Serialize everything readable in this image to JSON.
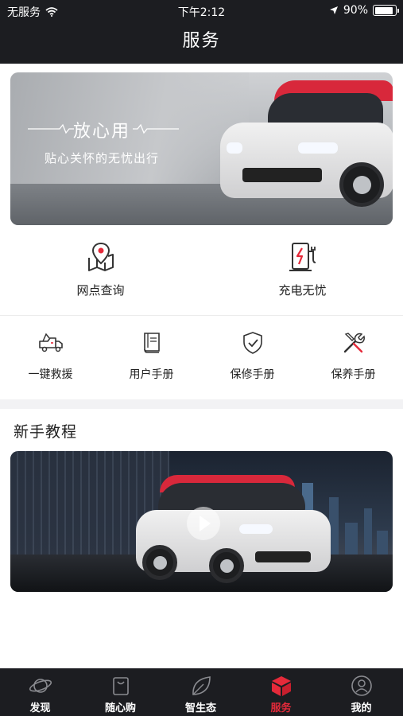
{
  "status_bar": {
    "carrier": "无服务",
    "time": "下午2:12",
    "battery": "90%",
    "battery_level": 0.9
  },
  "header": {
    "title": "服务"
  },
  "banner": {
    "headline": "放心用",
    "subtitle": "贴心关怀的无忧出行"
  },
  "quick_services": [
    {
      "label": "网点查询",
      "icon": "map-location-icon"
    },
    {
      "label": "充电无忧",
      "icon": "charging-station-icon"
    }
  ],
  "service_grid": [
    {
      "label": "一键救援",
      "icon": "tow-truck-icon"
    },
    {
      "label": "用户手册",
      "icon": "book-icon"
    },
    {
      "label": "保修手册",
      "icon": "shield-check-icon"
    },
    {
      "label": "保养手册",
      "icon": "tools-icon"
    }
  ],
  "tutorial": {
    "title": "新手教程"
  },
  "tabbar": {
    "active": "服务",
    "items": [
      {
        "label": "发现",
        "icon": "planet-icon"
      },
      {
        "label": "随心购",
        "icon": "shopping-bag-icon"
      },
      {
        "label": "智生态",
        "icon": "leaf-icon"
      },
      {
        "label": "服务",
        "icon": "service-box-icon"
      },
      {
        "label": "我的",
        "icon": "profile-icon"
      }
    ]
  },
  "colors": {
    "accent": "#e52a3a",
    "header_bg": "#1c1d21",
    "icon_stroke": "#333333"
  }
}
